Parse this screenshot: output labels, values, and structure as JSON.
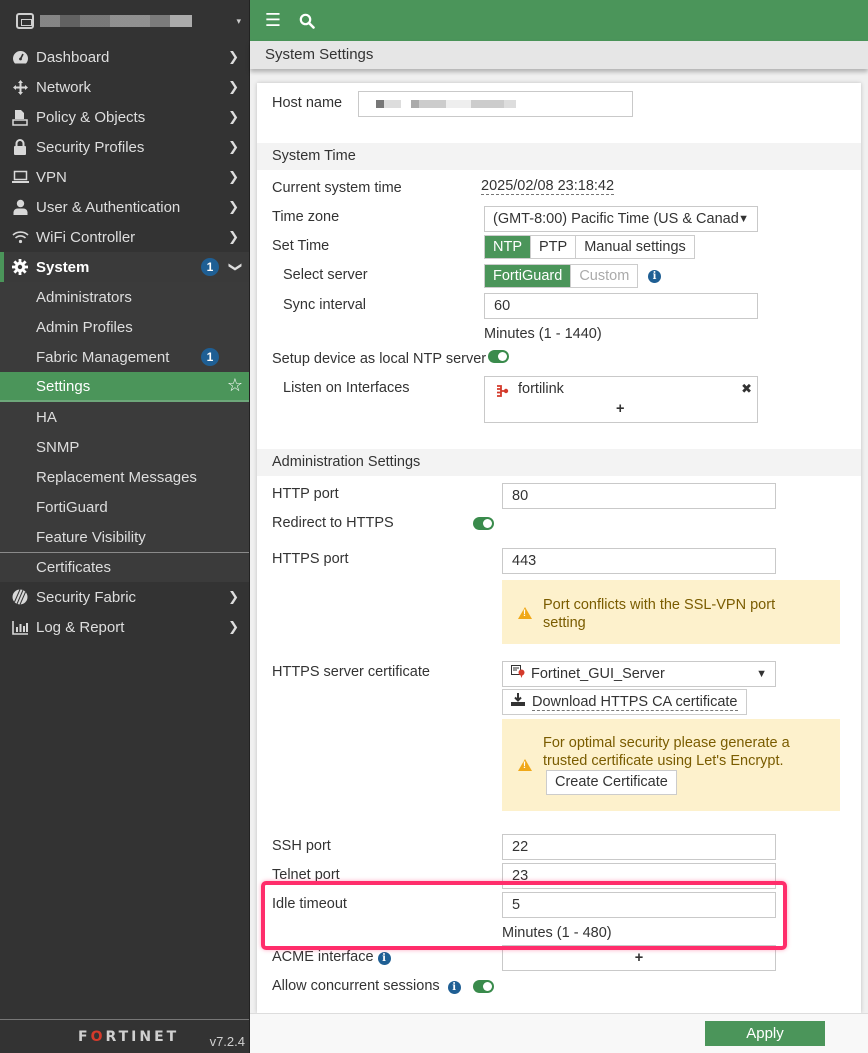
{
  "sidebar": {
    "device_caret": "▾",
    "items": [
      {
        "label": "Dashboard",
        "icon": "dashboard-icon"
      },
      {
        "label": "Network",
        "icon": "network-icon"
      },
      {
        "label": "Policy & Objects",
        "icon": "policy-icon"
      },
      {
        "label": "Security Profiles",
        "icon": "lock-icon"
      },
      {
        "label": "VPN",
        "icon": "laptop-icon"
      },
      {
        "label": "User & Authentication",
        "icon": "user-icon"
      },
      {
        "label": "WiFi Controller",
        "icon": "wifi-icon"
      }
    ],
    "system": {
      "label": "System",
      "badge": "1",
      "icon": "gear-icon"
    },
    "system_sub": [
      {
        "label": "Administrators"
      },
      {
        "label": "Admin Profiles"
      },
      {
        "label": "Fabric Management",
        "badge": "1"
      },
      {
        "label": "Settings",
        "active": true
      },
      {
        "label": "HA"
      },
      {
        "label": "SNMP"
      },
      {
        "label": "Replacement Messages"
      },
      {
        "label": "FortiGuard"
      },
      {
        "label": "Feature Visibility"
      },
      {
        "label": "Certificates"
      }
    ],
    "bottom_items": [
      {
        "label": "Security Fabric",
        "icon": "security-fabric-icon"
      },
      {
        "label": "Log & Report",
        "icon": "chart-icon"
      }
    ],
    "logo": {
      "pre": "F",
      "mid": "O",
      "post": "RTINET"
    },
    "version": "v7.2.4"
  },
  "topbar": {
    "menu_icon": "☰",
    "search_icon": "⚲"
  },
  "page_title": "System Settings",
  "host": {
    "label": "Host name",
    "value": ""
  },
  "system_time": {
    "section": "System Time",
    "current_label": "Current system time",
    "current_value": "2025/02/08 23:18:42",
    "tz_label": "Time zone",
    "tz_value": "(GMT-8:00) Pacific Time (US & Canad",
    "set_time_label": "Set Time",
    "set_time_options": [
      "NTP",
      "PTP",
      "Manual settings"
    ],
    "set_time_selected": "NTP",
    "server_label": "Select server",
    "server_options": [
      "FortiGuard",
      "Custom"
    ],
    "server_selected": "FortiGuard",
    "sync_label": "Sync interval",
    "sync_value": "60",
    "sync_hint": "Minutes (1 - 1440)",
    "local_ntp_label": "Setup device as local NTP server",
    "local_ntp_enabled": true,
    "listen_label": "Listen on Interfaces",
    "listen_interfaces": [
      "fortilink"
    ],
    "add_symbol": "+",
    "remove_symbol": "✖"
  },
  "admin": {
    "section": "Administration Settings",
    "http_label": "HTTP port",
    "http_value": "80",
    "redirect_label": "Redirect to HTTPS",
    "redirect_enabled": true,
    "https_label": "HTTPS port",
    "https_value": "443",
    "https_warning": "Port conflicts with the SSL-VPN port setting",
    "cert_label": "HTTPS server certificate",
    "cert_value": "Fortinet_GUI_Server",
    "download_ca_label": "Download HTTPS CA certificate",
    "cert_warning": "For optimal security please generate a trusted certificate using Let's Encrypt.",
    "create_cert_label": "Create Certificate",
    "ssh_label": "SSH port",
    "ssh_value": "22",
    "telnet_label": "Telnet port",
    "telnet_value": "23",
    "idle_label": "Idle timeout",
    "idle_value": "5",
    "idle_hint": "Minutes (1 - 480)",
    "acme_label": "ACME interface",
    "acme_add": "+",
    "concurrent_label": "Allow concurrent sessions",
    "concurrent_enabled": true
  },
  "footer": {
    "apply_label": "Apply"
  },
  "colors": {
    "accent": "#4b955a",
    "sidebar": "#333333",
    "badge": "#1f5f94",
    "warning_bg": "#fdf1cc",
    "highlight": "#ff2d6b"
  }
}
